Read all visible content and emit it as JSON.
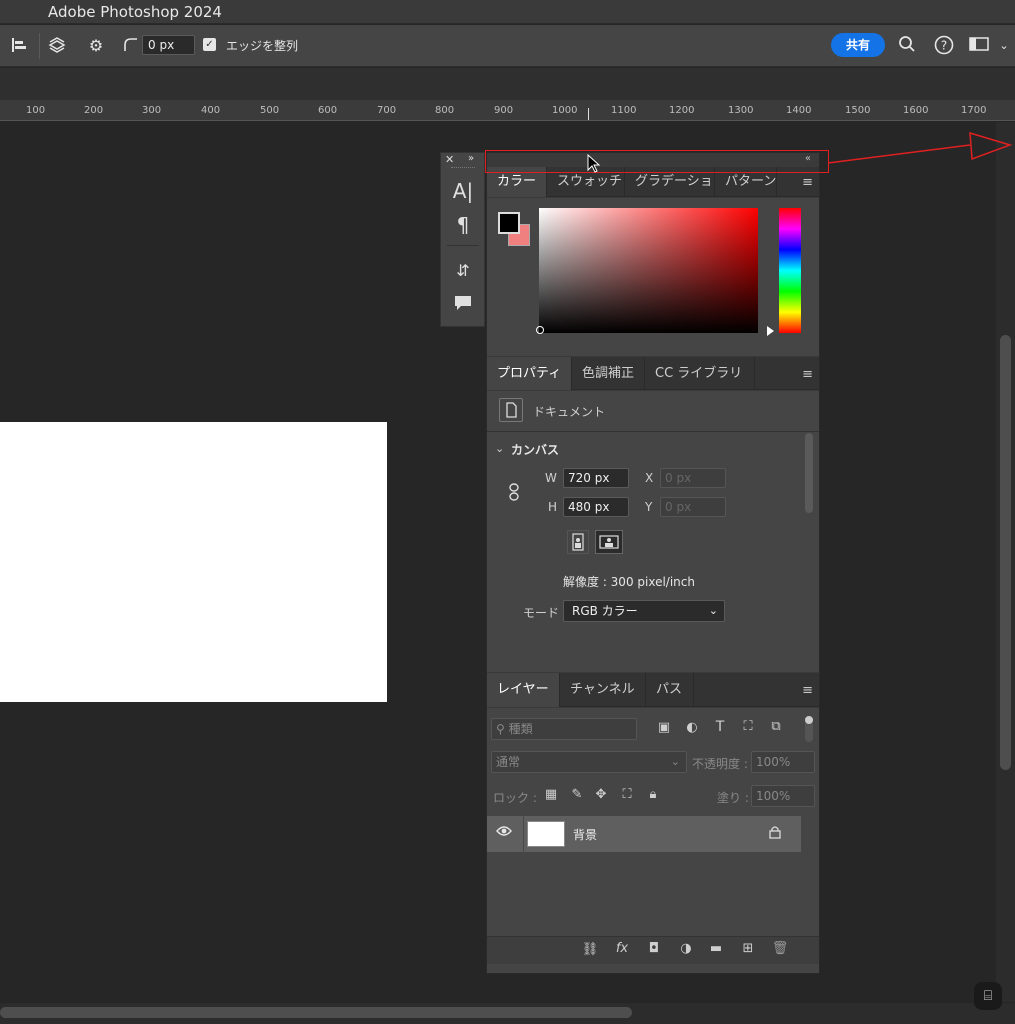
{
  "app": {
    "title": "Adobe Photoshop 2024"
  },
  "options_bar": {
    "radius_value": "0 px",
    "align_edges_label": "エッジを整列",
    "align_edges_checked": true,
    "share_label": "共有"
  },
  "ruler": {
    "ticks": [
      "100",
      "200",
      "300",
      "400",
      "500",
      "600",
      "700",
      "800",
      "900",
      "1000",
      "1100",
      "1200",
      "1300",
      "1400",
      "1500",
      "1600",
      "1700"
    ]
  },
  "mini_panel": {
    "items": [
      "character-icon",
      "paragraph-icon",
      "glyphs-icon",
      "comment-icon"
    ]
  },
  "color_panel": {
    "tabs": [
      "カラー",
      "スウォッチ",
      "グラデーショ",
      "パターン"
    ],
    "active_tab": "カラー",
    "foreground_color": "#000000",
    "background_color": "#f08080",
    "hue_color": "#ff0000"
  },
  "properties_panel": {
    "tabs": [
      "プロパティ",
      "色調補正",
      "CC ライブラリ"
    ],
    "doc_label": "ドキュメント",
    "canvas_section": "カンバス",
    "w_label": "W",
    "w_value": "720 px",
    "h_label": "H",
    "h_value": "480 px",
    "x_label": "X",
    "x_placeholder": "0 px",
    "y_label": "Y",
    "y_placeholder": "0 px",
    "resolution": "解像度 : 300 pixel/inch",
    "mode_label": "モード",
    "mode_value": "RGB カラー"
  },
  "layers_panel": {
    "tabs": [
      "レイヤー",
      "チャンネル",
      "パス"
    ],
    "filter_placeholder": "種類",
    "blend_mode": "通常",
    "opacity_label": "不透明度 :",
    "opacity_value": "100%",
    "lock_label": "ロック :",
    "fill_label": "塗り :",
    "fill_value": "100%",
    "layers": [
      {
        "name": "背景",
        "visible": true,
        "locked": true
      }
    ]
  }
}
